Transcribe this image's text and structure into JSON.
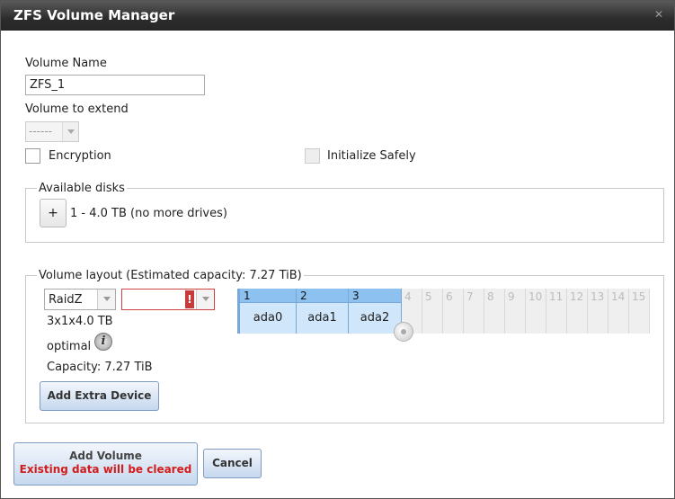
{
  "dialog": {
    "title": "ZFS Volume Manager",
    "close_icon": "close-x-icon"
  },
  "form": {
    "volume_name_label": "Volume Name",
    "volume_name_value": "ZFS_1",
    "volume_extend_label": "Volume to extend",
    "volume_extend_value": "------",
    "encryption_label": "Encryption",
    "encryption_checked": false,
    "initialize_label": "Initialize Safely",
    "initialize_checked": false
  },
  "available_disks": {
    "legend": "Available disks",
    "add_label": "+",
    "summary": "1 - 4.0 TB (no more drives)"
  },
  "layout": {
    "legend": "Volume layout (Estimated capacity: 7.27 TiB)",
    "raid_type": "RaidZ",
    "second_select_value": "",
    "error_mark": "!",
    "config": "3x1x4.0 TB",
    "status": "optimal",
    "info_icon": "info-icon",
    "capacity": "Capacity: 7.27 TiB",
    "add_extra_device": "Add Extra Device",
    "columns": [
      {
        "num": "1",
        "disk": "ada0"
      },
      {
        "num": "2",
        "disk": "ada1"
      },
      {
        "num": "3",
        "disk": "ada2"
      }
    ],
    "empty_columns": [
      "4",
      "5",
      "6",
      "7",
      "8",
      "9",
      "10",
      "11",
      "12",
      "13",
      "14",
      "15"
    ]
  },
  "buttons": {
    "add_volume": "Add Volume",
    "add_volume_warning": "Existing data will be cleared",
    "cancel": "Cancel"
  },
  "colors": {
    "titlebar": "#2c2c2c",
    "accent": "#8cc1f0",
    "warning": "#d21d1d"
  }
}
